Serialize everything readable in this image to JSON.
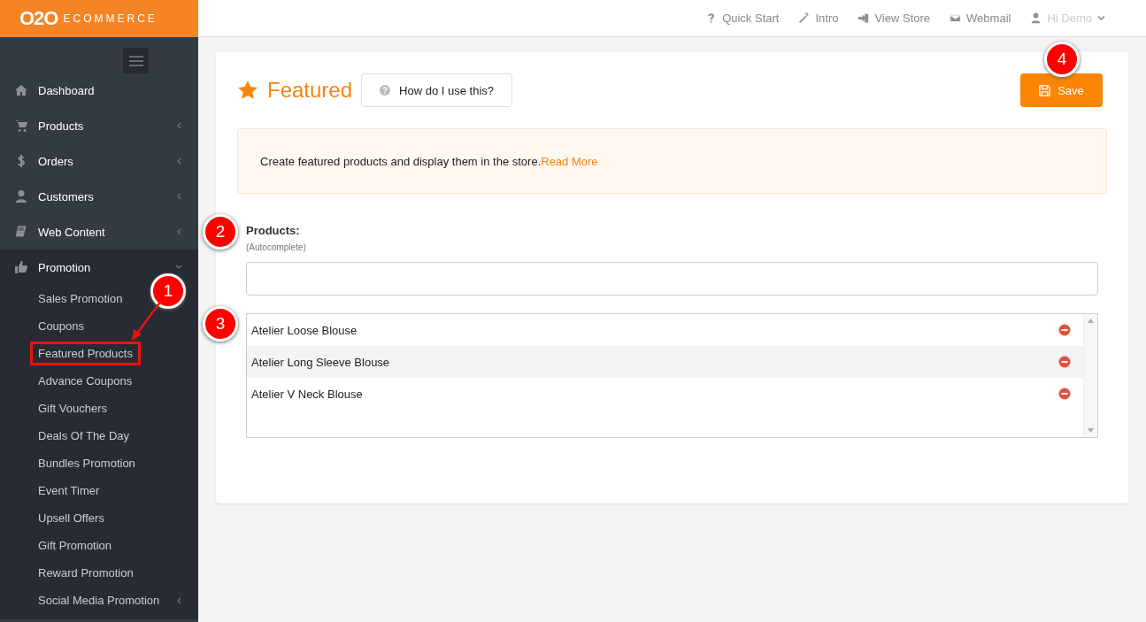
{
  "logo": {
    "mark": "O2O",
    "word": "ECOMMERCE"
  },
  "topbar": [
    {
      "kind": "question",
      "label": "Quick Start"
    },
    {
      "kind": "wand",
      "label": "Intro"
    },
    {
      "kind": "signin",
      "label": "View Store"
    },
    {
      "kind": "mail",
      "label": "Webmail"
    },
    {
      "kind": "user",
      "label": "Hi Demo"
    }
  ],
  "sidebar": {
    "items": [
      {
        "kind": "home",
        "label": "Dashboard"
      },
      {
        "kind": "cart",
        "label": "Products",
        "expanded": false
      },
      {
        "kind": "dollar",
        "label": "Orders",
        "expanded": false
      },
      {
        "kind": "user",
        "label": "Customers",
        "expanded": false
      },
      {
        "kind": "book",
        "label": "Web Content",
        "expanded": false
      },
      {
        "kind": "thumb",
        "label": "Promotion",
        "expanded": true,
        "children": [
          {
            "label": "Sales Promotion",
            "highlighted": false
          },
          {
            "label": "Coupons",
            "highlighted": false
          },
          {
            "label": "Featured Products",
            "highlighted": true
          },
          {
            "label": "Advance Coupons",
            "highlighted": false
          },
          {
            "label": "Gift Vouchers",
            "highlighted": false
          },
          {
            "label": "Deals Of The Day",
            "highlighted": false
          },
          {
            "label": "Bundles Promotion",
            "highlighted": false
          },
          {
            "label": "Event Timer",
            "highlighted": false
          },
          {
            "label": "Upsell Offers",
            "highlighted": false
          },
          {
            "label": "Gift Promotion",
            "highlighted": false
          },
          {
            "label": "Reward Promotion",
            "highlighted": false
          },
          {
            "label": "Social Media Promotion",
            "expanded": false,
            "highlighted": false
          }
        ]
      }
    ]
  },
  "page": {
    "title": "Featured",
    "help_button": "How do I use this?",
    "save_button": "Save",
    "info": {
      "text": "Create featured products and display them in the store.",
      "link": "Read More"
    },
    "field": {
      "label": "Products:",
      "hint": "(Autocomplete)"
    },
    "products": [
      "Atelier Loose Blouse",
      "Atelier Long Sleeve Blouse",
      "Atelier V Neck Blouse"
    ]
  },
  "annotations": [
    "1",
    "2",
    "3",
    "4"
  ]
}
